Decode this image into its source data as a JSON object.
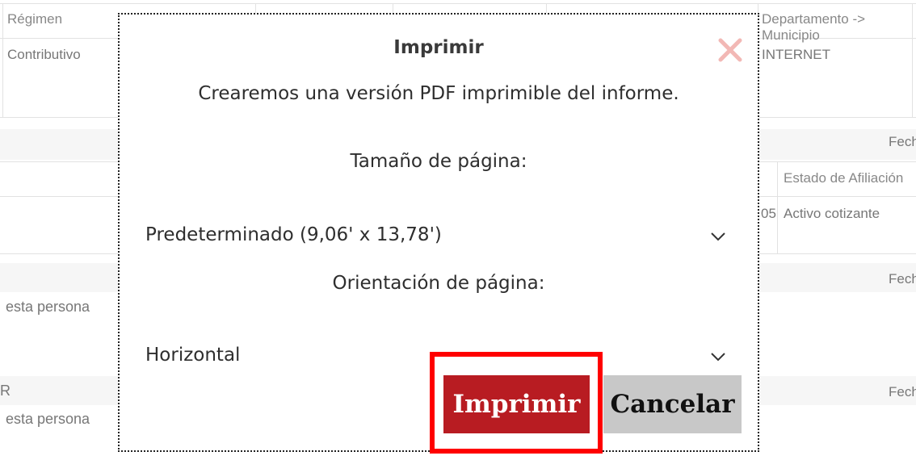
{
  "background": {
    "col_regimen_header": "Régimen",
    "col_regimen_value": "Contributivo",
    "col_depto_header": "Departamento -> Municipio",
    "col_depto_value": "INTERNET",
    "fecha_label_1": "Fech",
    "estado_header": "Estado de Afiliación",
    "estado_prefix": "05",
    "estado_value": "Activo cotizante",
    "fecha_label_2": "Fech",
    "left_text_1": "esta persona",
    "left_text_2_prefix": "R",
    "fecha_label_3": "Fech",
    "left_text_2": "esta persona"
  },
  "modal": {
    "title": "Imprimir",
    "description": "Crearemos una versión PDF imprimible del informe.",
    "page_size_label": "Tamaño de página:",
    "page_size_value": "Predeterminado (9,06' x 13,78')",
    "orientation_label": "Orientación de página:",
    "orientation_value": "Horizontal",
    "print_button": "Imprimir",
    "cancel_button": "Cancelar",
    "close_icon": "close-icon",
    "chevron_icon": "chevron-down-icon"
  },
  "colors": {
    "print_button": "#b81c22",
    "cancel_button": "#c8c8c8",
    "highlight_outline": "#ff0000",
    "close_icon": "#f2b8b5"
  }
}
